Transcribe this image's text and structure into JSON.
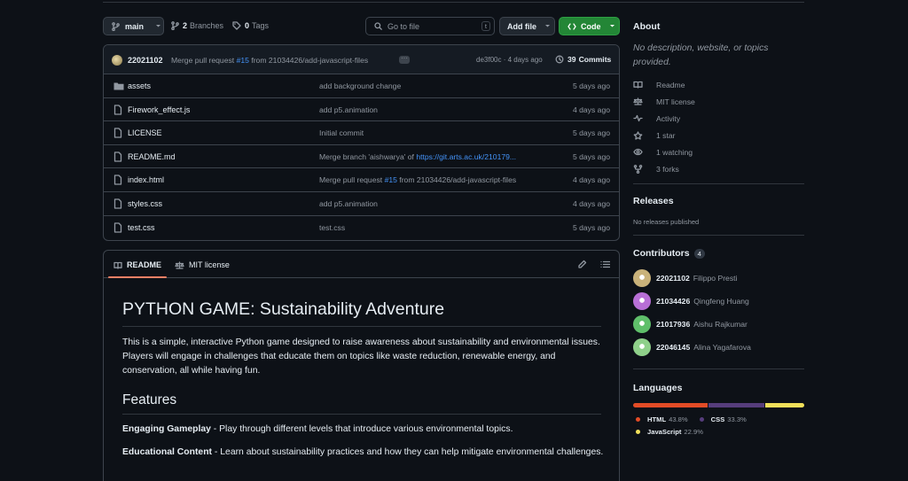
{
  "toolbar": {
    "branch": "main",
    "branches_count": "2",
    "branches_label": "Branches",
    "tags_count": "0",
    "tags_label": "Tags",
    "go_to_file_placeholder": "Go to file",
    "go_to_file_shortcut": "t",
    "add_file_label": "Add file",
    "code_label": "Code"
  },
  "commit": {
    "author": "22021102",
    "message_prefix": "Merge pull request",
    "pr_link": "#15",
    "message_suffix": "from 21034426/add-javascript-files",
    "sha": "de3f00c",
    "sep": "·",
    "time": "4 days ago",
    "commits_count": "39",
    "commits_label": "Commits"
  },
  "files": [
    {
      "name": "assets",
      "type": "folder",
      "message": "add background change",
      "date": "5 days ago"
    },
    {
      "name": "Firework_effect.js",
      "type": "file",
      "message": "add p5.animation",
      "date": "4 days ago"
    },
    {
      "name": "LICENSE",
      "type": "file",
      "message": "Initial commit",
      "date": "5 days ago"
    },
    {
      "name": "README.md",
      "type": "file",
      "message_prefix": "Merge branch 'aishwarya' of ",
      "message_link": "https://git.arts.ac.uk/210179...",
      "date": "5 days ago"
    },
    {
      "name": "index.html",
      "type": "file",
      "message_prefix": "Merge pull request ",
      "message_link": "#15",
      "message_suffix": " from 21034426/add-javascript-files",
      "date": "4 days ago"
    },
    {
      "name": "styles.css",
      "type": "file",
      "message": "add p5.animation",
      "date": "4 days ago"
    },
    {
      "name": "test.css",
      "type": "file",
      "message": "test.css",
      "date": "5 days ago"
    }
  ],
  "readme": {
    "tab_readme": "README",
    "tab_license": "MIT license",
    "title": "PYTHON GAME: Sustainability Adventure",
    "intro": "This is a simple, interactive Python game designed to raise awareness about sustainability and environmental issues. Players will engage in challenges that educate them on topics like waste reduction, renewable energy, and conservation, all while having fun.",
    "features_heading": "Features",
    "feature1_title": "Engaging Gameplay",
    "feature1_text": " - Play through different levels that introduce various environmental topics.",
    "feature2_title": "Educational Content",
    "feature2_text": " - Learn about sustainability practices and how they can help mitigate environmental challenges."
  },
  "about": {
    "heading": "About",
    "description": "No description, website, or topics provided.",
    "items": [
      {
        "label": "Readme",
        "icon": "book-icon"
      },
      {
        "label": "MIT license",
        "icon": "scale-icon"
      },
      {
        "label": "Activity",
        "icon": "pulse-icon"
      },
      {
        "label": "1 star",
        "icon": "star-icon"
      },
      {
        "label": "1 watching",
        "icon": "eye-icon"
      },
      {
        "label": "3 forks",
        "icon": "fork-icon"
      }
    ]
  },
  "releases": {
    "heading": "Releases",
    "text": "No releases published"
  },
  "contributors": {
    "heading": "Contributors",
    "count": "4",
    "list": [
      {
        "login": "22021102",
        "name": "Filippo Presti",
        "color": "#c9b27a"
      },
      {
        "login": "21034426",
        "name": "Qingfeng Huang",
        "color": "#b86fd6"
      },
      {
        "login": "21017936",
        "name": "Aishu Rajkumar",
        "color": "#5fbf6a"
      },
      {
        "login": "22046145",
        "name": "Alina Yagafarova",
        "color": "#8fd08a"
      }
    ]
  },
  "languages": {
    "heading": "Languages",
    "list": [
      {
        "name": "HTML",
        "percent": "43.8%",
        "value": 43.8,
        "color": "#e34c26"
      },
      {
        "name": "CSS",
        "percent": "33.3%",
        "value": 33.3,
        "color": "#563d7c"
      },
      {
        "name": "JavaScript",
        "percent": "22.9%",
        "value": 22.9,
        "color": "#f1e05a"
      }
    ]
  },
  "colors": {
    "accent_green": "#238636",
    "link": "#4493f8",
    "bg": "#0d1117",
    "border": "#3d444d"
  }
}
